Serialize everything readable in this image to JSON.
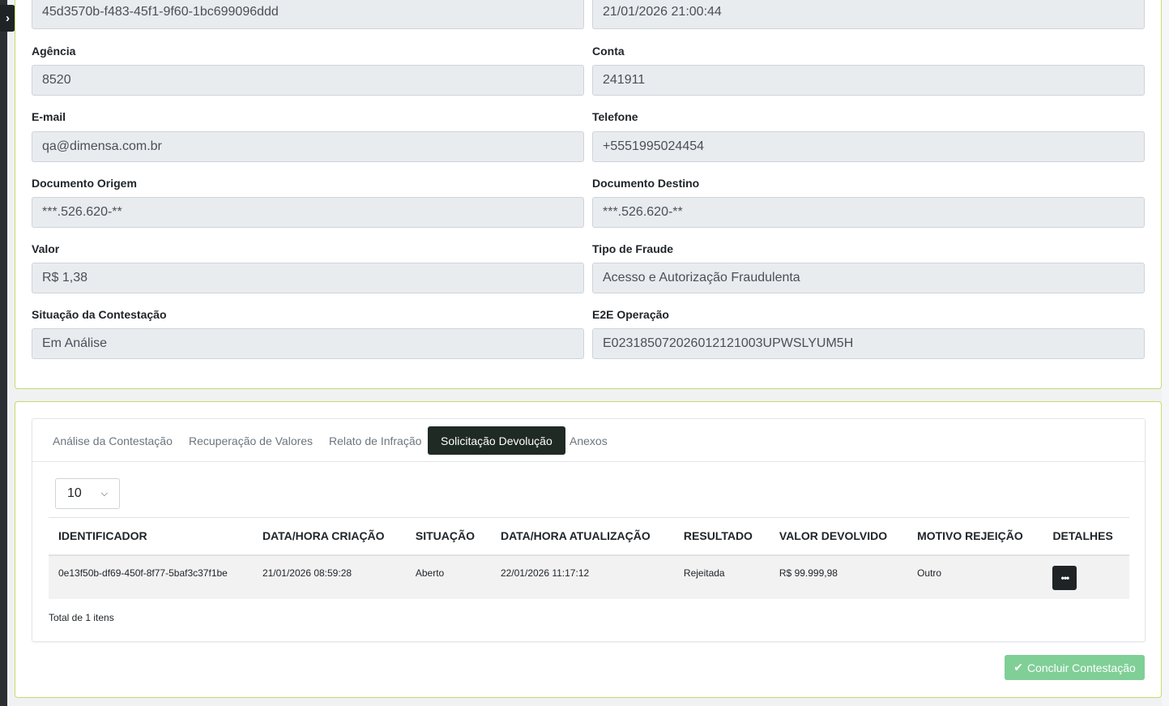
{
  "details": {
    "id_value": "45d3570b-f483-45f1-9f60-1bc699096ddd",
    "date_value": "21/01/2026 21:00:44",
    "agencia": {
      "label": "Agência",
      "value": "8520"
    },
    "conta": {
      "label": "Conta",
      "value": "241911"
    },
    "email": {
      "label": "E-mail",
      "value": "qa@dimensa.com.br"
    },
    "telefone": {
      "label": "Telefone",
      "value": "+5551995024454"
    },
    "doc_origem": {
      "label": "Documento Origem",
      "value": "***.526.620-**"
    },
    "doc_destino": {
      "label": "Documento Destino",
      "value": "***.526.620-**"
    },
    "valor": {
      "label": "Valor",
      "value": "R$ 1,38"
    },
    "tipo_fraude": {
      "label": "Tipo de Fraude",
      "value": "Acesso e Autorização Fraudulenta"
    },
    "situacao": {
      "label": "Situação da Contestação",
      "value": "Em Análise"
    },
    "e2e": {
      "label": "E2E Operação",
      "value": "E02318507202601212100 3UPWSLYUM5H"
    }
  },
  "tabs": [
    {
      "label": "Análise da Contestação",
      "active": false
    },
    {
      "label": "Recuperação de Valores",
      "active": false
    },
    {
      "label": "Relato de Infração",
      "active": false
    },
    {
      "label": "Solicitação Devolução",
      "active": true
    },
    {
      "label": "Anexos",
      "active": false
    }
  ],
  "page_size": {
    "selected": "10"
  },
  "table": {
    "columns": [
      "IDENTIFICADOR",
      "DATA/HORA CRIAÇÃO",
      "SITUAÇÃO",
      "DATA/HORA ATUALIZAÇÃO",
      "RESULTADO",
      "VALOR DEVOLVIDO",
      "MOTIVO REJEIÇÃO",
      "DETALHES"
    ],
    "rows": [
      {
        "identificador": "0e13f50b-df69-450f-8f77-5baf3c37f1be",
        "criacao": "21/01/2026 08:59:28",
        "situacao": "Aberto",
        "atualizacao": "22/01/2026 11:17:12",
        "resultado": "Rejeitada",
        "valor": "R$ 99.999,98",
        "motivo": "Outro",
        "detalhes_label": "•••"
      }
    ],
    "total": "Total de 1 itens"
  },
  "actions": {
    "conclude_label": "Concluir Contestação"
  },
  "icons": {
    "sidebar_toggle": "chevron-right-icon",
    "conclude": "check-icon",
    "details": "ellipsis-icon",
    "select": "chevron-down-icon"
  },
  "colors": {
    "accent_border": "#c5dc6b",
    "active_tab": "#1f2a24",
    "success_button": "#7fcf96"
  }
}
